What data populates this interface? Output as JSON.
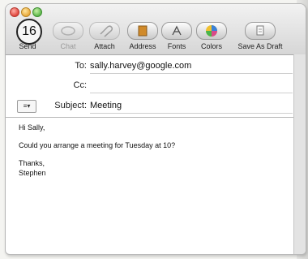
{
  "toolbar": {
    "send_badge": "16",
    "send_label": "Send",
    "chat_label": "Chat",
    "attach_label": "Attach",
    "address_label": "Address",
    "fonts_label": "Fonts",
    "colors_label": "Colors",
    "save_draft_label": "Save As Draft"
  },
  "headers": {
    "to_label": "To:",
    "to_value": "sally.harvey@google.com",
    "cc_label": "Cc:",
    "cc_value": "",
    "subject_label": "Subject:",
    "subject_value": "Meeting",
    "options_menu_glyph": "≡▾"
  },
  "message": {
    "greeting": "Hi Sally,",
    "line1": "Could you arrange a meeting for Tuesday at 10?",
    "closing": "Thanks,",
    "signature": "Stephen"
  },
  "colors": {
    "toolbar_top": "#f2f2f2",
    "toolbar_bottom": "#d6d6d6",
    "close": "#e0443b",
    "minimize": "#e9a93a",
    "zoom": "#5cb84a"
  },
  "icons": {
    "send": "send-circle-icon",
    "chat": "chat-icon",
    "attach": "paperclip-icon",
    "address": "address-book-icon",
    "fonts": "fonts-icon",
    "colors": "color-wheel-icon",
    "save_draft": "draft-document-icon"
  }
}
